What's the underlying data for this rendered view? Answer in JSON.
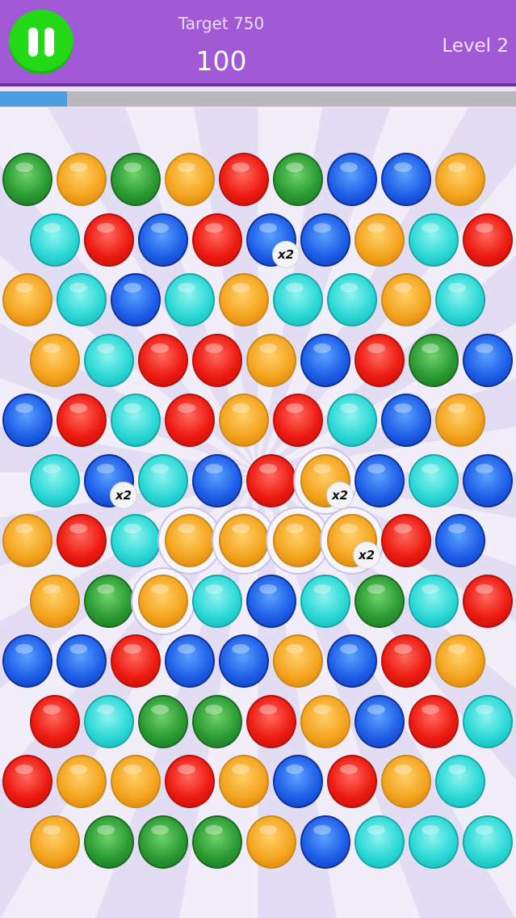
{
  "header": {
    "target_label": "Target 750",
    "score": "100",
    "level_label": "Level 2",
    "progress_fraction": 0.13
  },
  "colors": {
    "header_bg": "#a259d6",
    "pause_button": "#23d815",
    "progress_fill": "#4d9de1",
    "progress_track": "#b9b9bd"
  },
  "board": {
    "rows": [
      [
        "green",
        "orange",
        "green",
        "orange",
        "red",
        "green",
        "blue",
        "blue",
        "orange"
      ],
      [
        "cyan",
        "red",
        "blue",
        "red",
        "blue:x2",
        "blue",
        "orange",
        "cyan",
        "red"
      ],
      [
        "orange",
        "cyan",
        "blue",
        "cyan",
        "orange",
        "cyan",
        "cyan",
        "orange",
        "cyan"
      ],
      [
        "orange",
        "cyan",
        "red",
        "red",
        "orange",
        "blue",
        "red",
        "green",
        "blue"
      ],
      [
        "blue",
        "red",
        "cyan",
        "red",
        "orange",
        "red",
        "cyan",
        "blue",
        "orange"
      ],
      [
        "cyan",
        "blue:x2",
        "cyan",
        "blue",
        "red",
        "orange:x2*",
        "blue",
        "cyan",
        "blue"
      ],
      [
        "orange",
        "red",
        "cyan",
        "orange*",
        "orange*",
        "orange*",
        "orange:x2*",
        "red",
        "blue"
      ],
      [
        "orange",
        "green",
        "orange*",
        "cyan",
        "blue",
        "cyan",
        "green",
        "cyan",
        "red"
      ],
      [
        "blue",
        "blue",
        "red",
        "blue",
        "blue",
        "orange",
        "blue",
        "red",
        "orange"
      ],
      [
        "red",
        "cyan",
        "green",
        "green",
        "red",
        "orange",
        "blue",
        "red",
        "cyan"
      ],
      [
        "red",
        "orange",
        "orange",
        "red",
        "orange",
        "blue",
        "red",
        "orange",
        "cyan"
      ],
      [
        "orange",
        "green",
        "green",
        "green",
        "orange",
        "blue",
        "cyan",
        "cyan",
        "cyan"
      ]
    ],
    "multiplier_text": "x2",
    "selected_chain": [
      [
        7,
        2
      ],
      [
        6,
        3
      ],
      [
        6,
        4
      ],
      [
        6,
        5
      ],
      [
        6,
        6
      ],
      [
        5,
        5
      ]
    ]
  }
}
